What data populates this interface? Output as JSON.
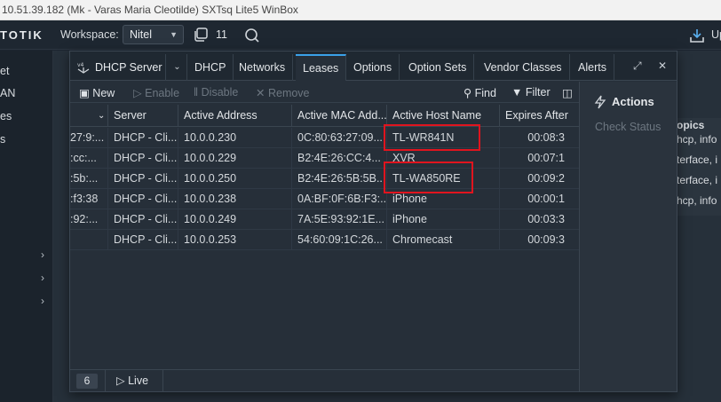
{
  "os_title": "10.51.39.182 (Mk - Varas Maria Cleotilde) SXTsq Lite5 WinBox",
  "brand": "TOTIK",
  "topbar": {
    "workspace_label": "Workspace:",
    "workspace_value": "Nitel",
    "window_count": "11",
    "update_label": "Up"
  },
  "sidebar": {
    "items": [
      "et",
      "AN",
      "es",
      "s"
    ]
  },
  "background_right": {
    "header": "opics",
    "lines": [
      "hcp, info",
      "terface, i",
      "terface, i",
      "hcp, info"
    ]
  },
  "window": {
    "title": "DHCP Server",
    "tabs": [
      "DHCP",
      "Networks",
      "Leases",
      "Options",
      "Option Sets",
      "Vendor Classes",
      "Alerts"
    ],
    "active_tab": "Leases",
    "toolbar": {
      "new": "New",
      "enable": "Enable",
      "disable": "Disable",
      "remove": "Remove",
      "find": "Find",
      "filter": "Filter"
    },
    "table": {
      "columns": [
        "",
        "Server",
        "Active Address",
        "Active MAC Add...",
        "Active Host Name",
        "Expires After"
      ],
      "rows": [
        [
          "27:9:...",
          "DHCP - Cli...",
          "10.0.0.230",
          "0C:80:63:27:09...",
          "TL-WR841N",
          "00:08:3"
        ],
        [
          ":cc:...",
          "DHCP - Cli...",
          "10.0.0.229",
          "B2:4E:26:CC:4...",
          "XVR",
          "00:07:1"
        ],
        ":5b:...",
        [
          "",
          "",
          "",
          "",
          "",
          ""
        ],
        [
          ":f3:38",
          "DHCP - Cli...",
          "10.0.0.238",
          "0A:BF:0F:6B:F3:...",
          "iPhone",
          "00:00:1"
        ],
        [
          ":92:...",
          "DHCP - Cli...",
          "10.0.0.249",
          "7A:5E:93:92:1E...",
          "iPhone",
          "00:03:3"
        ],
        [
          "",
          "DHCP - Cli...",
          "10.0.0.253",
          "54:60:09:1C:26...",
          "Chromecast",
          "00:09:3"
        ]
      ],
      "row3": [
        ":5b:...",
        "DHCP - Cli...",
        "10.0.0.250",
        "B2:4E:26:5B:5B...",
        "TL-WA850RE",
        "00:09:2"
      ]
    },
    "status": {
      "count": "6",
      "live": "Live"
    },
    "actions": {
      "title": "Actions",
      "check_status": "Check Status"
    }
  }
}
